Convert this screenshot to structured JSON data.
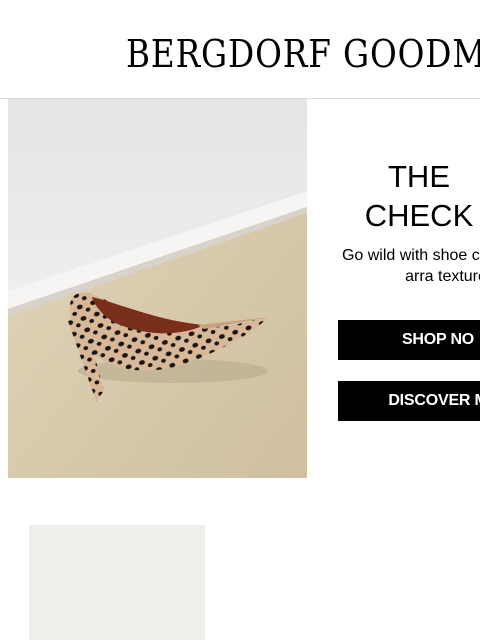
{
  "header": {
    "logo_text": "BERGDORF GOODMAN"
  },
  "hero": {
    "image_subject": "leopard-print pointed-toe pump on carpet",
    "headline_line1": "THE",
    "headline_line2": "CHECK",
    "description": "Go wild with shoe cast in a fun arra textures",
    "shop_button_label": "SHOP NO",
    "discover_button_label": "DISCOVER M"
  },
  "colors": {
    "button_bg": "#000000",
    "button_text": "#ffffff",
    "divider": "#d9d9d9",
    "tile_bg": "#efeeeb"
  }
}
